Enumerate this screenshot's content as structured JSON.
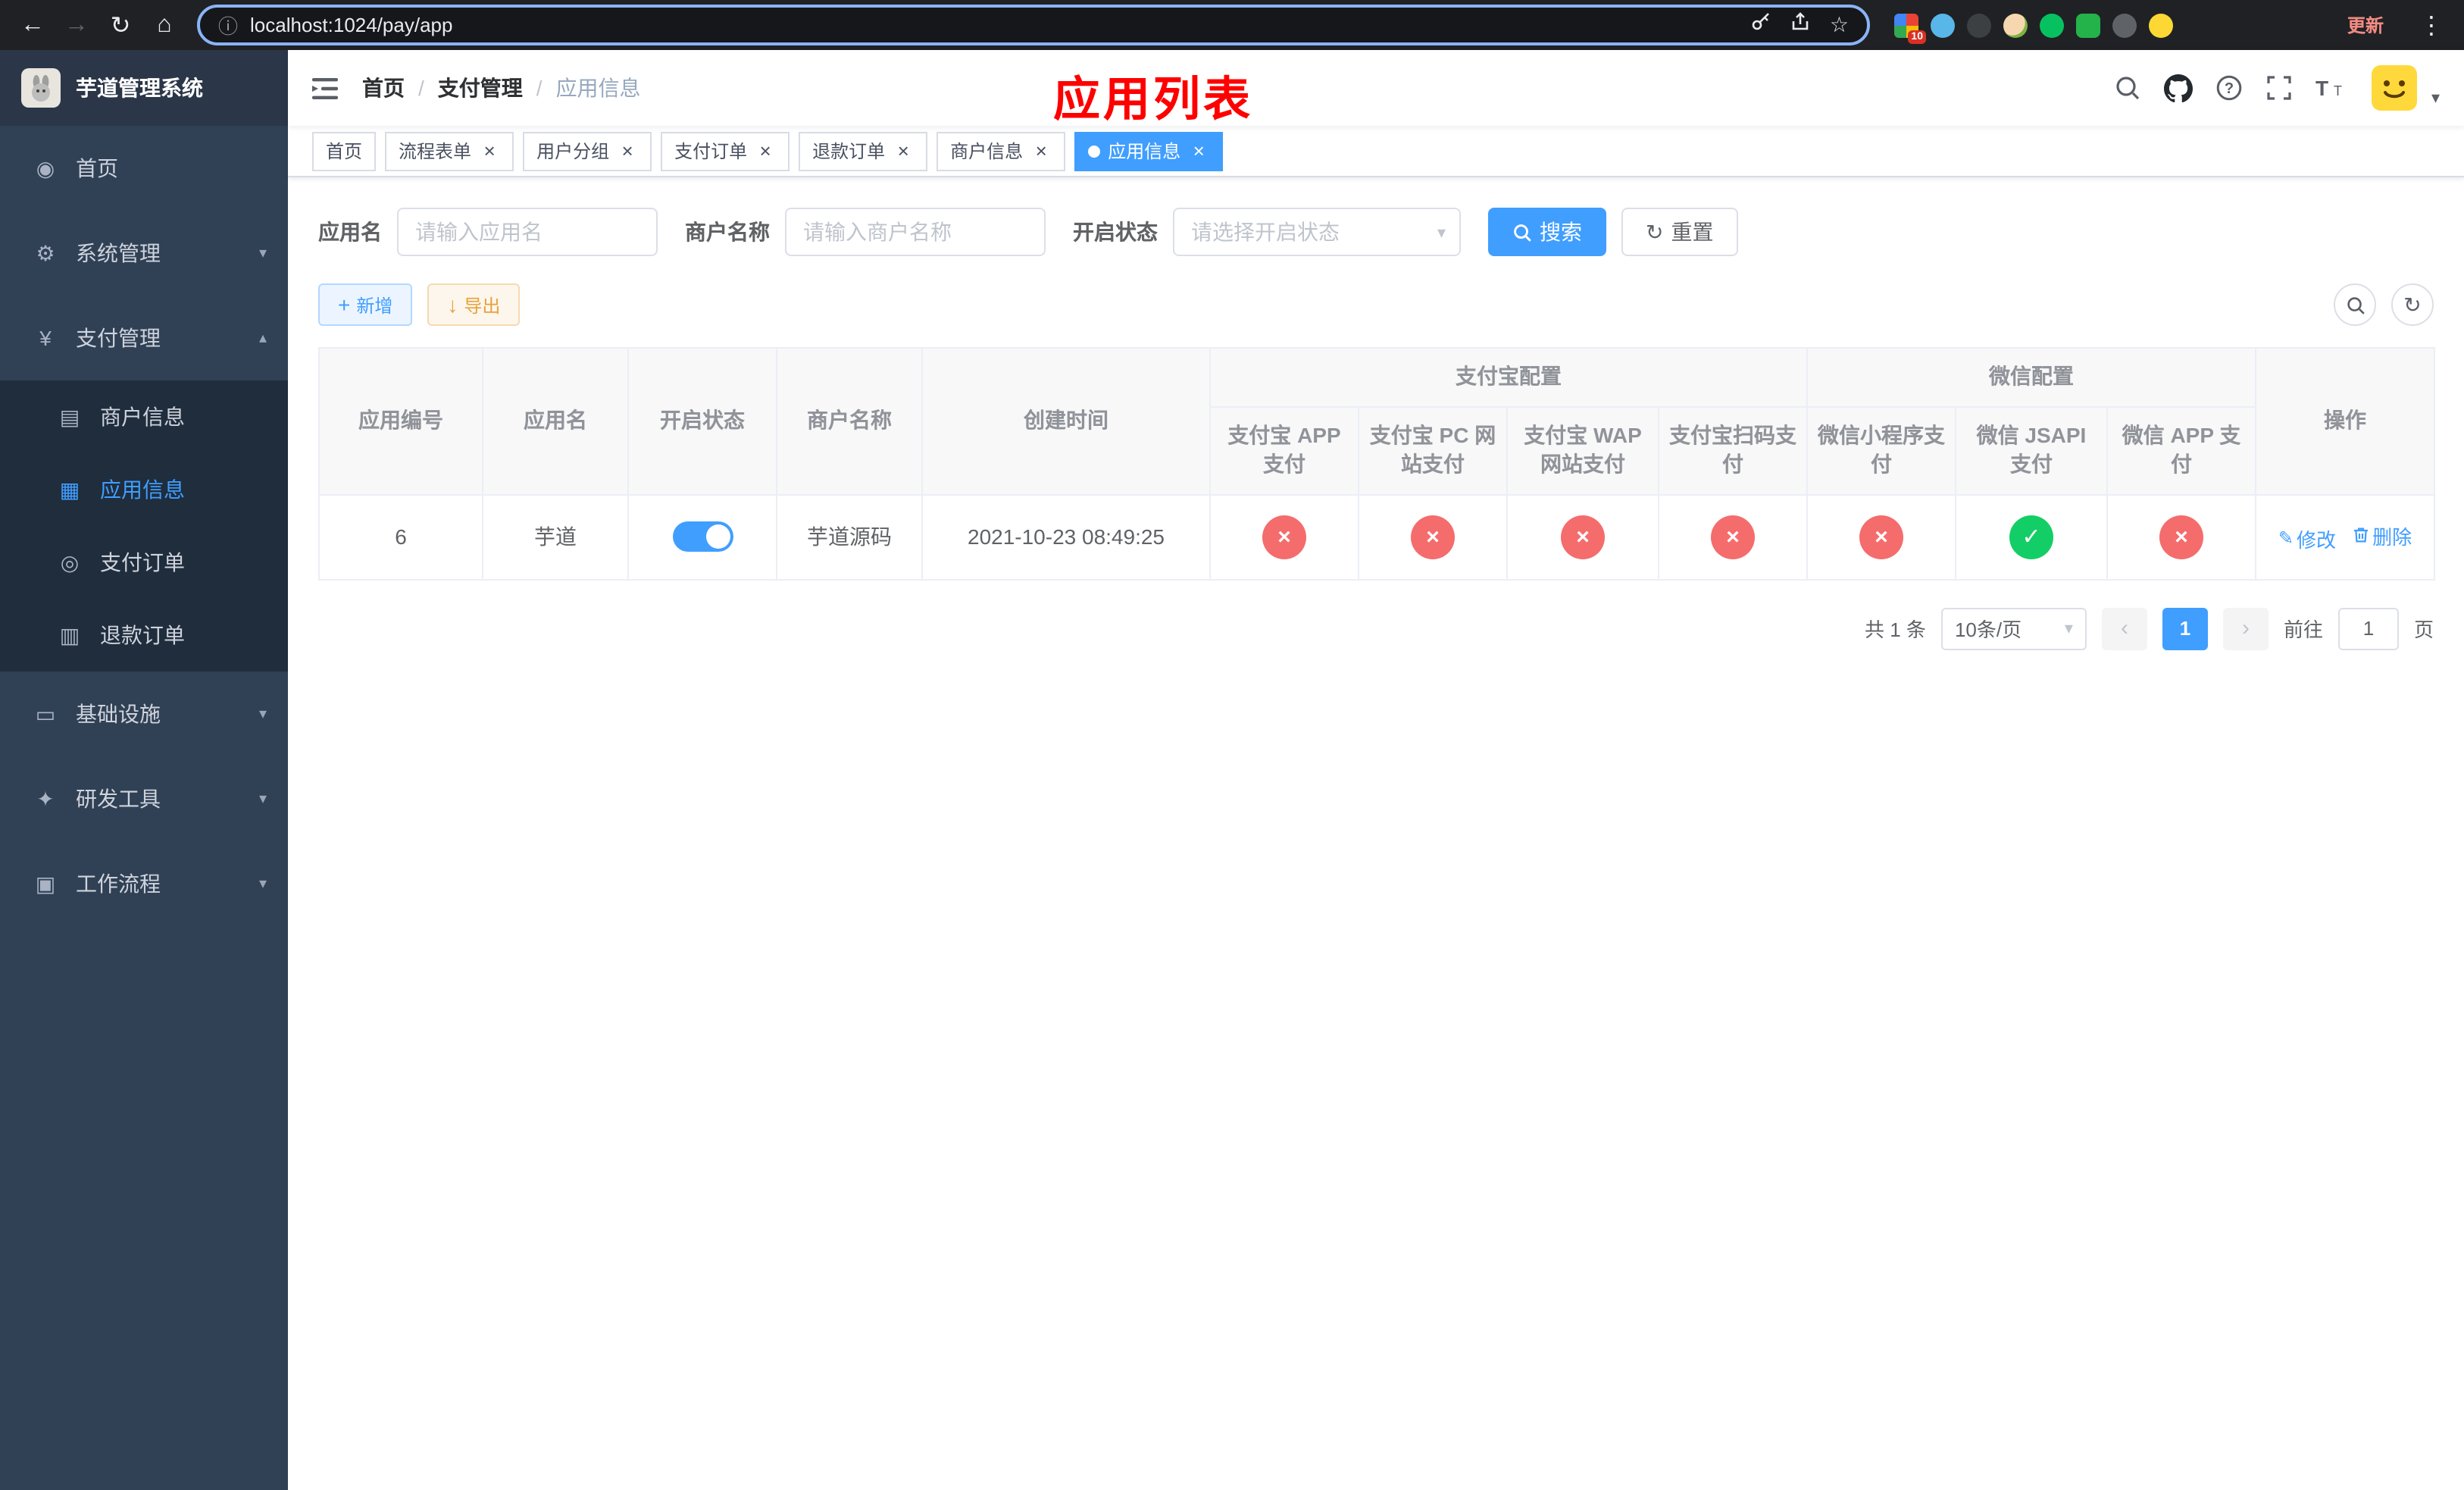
{
  "browser": {
    "url": "localhost:1024/pay/app",
    "update_label": "更新",
    "extension_badge": "10"
  },
  "sidebar": {
    "logo_title": "芋道管理系统",
    "menu": [
      {
        "id": "home",
        "label": "首页",
        "icon": "dashboard-icon",
        "type": "item"
      },
      {
        "id": "system",
        "label": "系统管理",
        "icon": "gear-icon",
        "type": "submenu",
        "expanded": false
      },
      {
        "id": "payment",
        "label": "支付管理",
        "icon": "yen-icon",
        "type": "submenu",
        "expanded": true,
        "children": [
          {
            "id": "merchant-info",
            "label": "商户信息",
            "icon": "card-icon",
            "active": false
          },
          {
            "id": "app-info",
            "label": "应用信息",
            "icon": "grid-icon",
            "active": true
          },
          {
            "id": "pay-order",
            "label": "支付订单",
            "icon": "order-icon",
            "active": false
          },
          {
            "id": "refund-order",
            "label": "退款订单",
            "icon": "doc-icon",
            "active": false
          }
        ]
      },
      {
        "id": "infrastructure",
        "label": "基础设施",
        "icon": "infra-icon",
        "type": "submenu",
        "expanded": false
      },
      {
        "id": "dev-tools",
        "label": "研发工具",
        "icon": "tools-icon",
        "type": "submenu",
        "expanded": false
      },
      {
        "id": "workflow",
        "label": "工作流程",
        "icon": "workflow-icon",
        "type": "submenu",
        "expanded": false
      }
    ]
  },
  "navbar": {
    "breadcrumb": [
      "首页",
      "支付管理",
      "应用信息"
    ],
    "annotation_title": "应用列表"
  },
  "tags_view": [
    {
      "label": "首页",
      "closable": false,
      "active": false
    },
    {
      "label": "流程表单",
      "closable": true,
      "active": false
    },
    {
      "label": "用户分组",
      "closable": true,
      "active": false
    },
    {
      "label": "支付订单",
      "closable": true,
      "active": false
    },
    {
      "label": "退款订单",
      "closable": true,
      "active": false
    },
    {
      "label": "商户信息",
      "closable": true,
      "active": false
    },
    {
      "label": "应用信息",
      "closable": true,
      "active": true
    }
  ],
  "filters": {
    "app_name_label": "应用名",
    "app_name_placeholder": "请输入应用名",
    "merchant_label": "商户名称",
    "merchant_placeholder": "请输入商户名称",
    "status_label": "开启状态",
    "status_placeholder": "请选择开启状态",
    "search_button": "搜索",
    "reset_button": "重置"
  },
  "toolbar": {
    "add_button": "新增",
    "export_button": "导出"
  },
  "table": {
    "columns": {
      "id": "应用编号",
      "app_name": "应用名",
      "status": "开启状态",
      "merchant_name": "商户名称",
      "created_at": "创建时间",
      "actions": "操作"
    },
    "groups": [
      {
        "label": "支付宝配置",
        "columns": [
          "支付宝 APP 支付",
          "支付宝 PC 网站支付",
          "支付宝 WAP 网站支付",
          "支付宝扫码支付"
        ]
      },
      {
        "label": "微信配置",
        "columns": [
          "微信小程序支付",
          "微信 JSAPI 支付",
          "微信 APP 支付"
        ]
      }
    ],
    "rows": [
      {
        "id": "6",
        "app_name": "芋道",
        "enabled": true,
        "merchant_name": "芋道源码",
        "created_at": "2021-10-23 08:49:25",
        "configs": [
          false,
          false,
          false,
          false,
          false,
          true,
          false
        ],
        "edit_label": "修改",
        "delete_label": "删除"
      }
    ]
  },
  "pagination": {
    "total_text": "共 1 条",
    "page_size_text": "10条/页",
    "current_page": "1",
    "goto_prefix": "前往",
    "goto_value": "1",
    "goto_suffix": "页"
  },
  "colors": {
    "primary": "#409eff",
    "danger": "#f56c6c",
    "success": "#13ce66",
    "annotation_red": "#fe0000"
  }
}
